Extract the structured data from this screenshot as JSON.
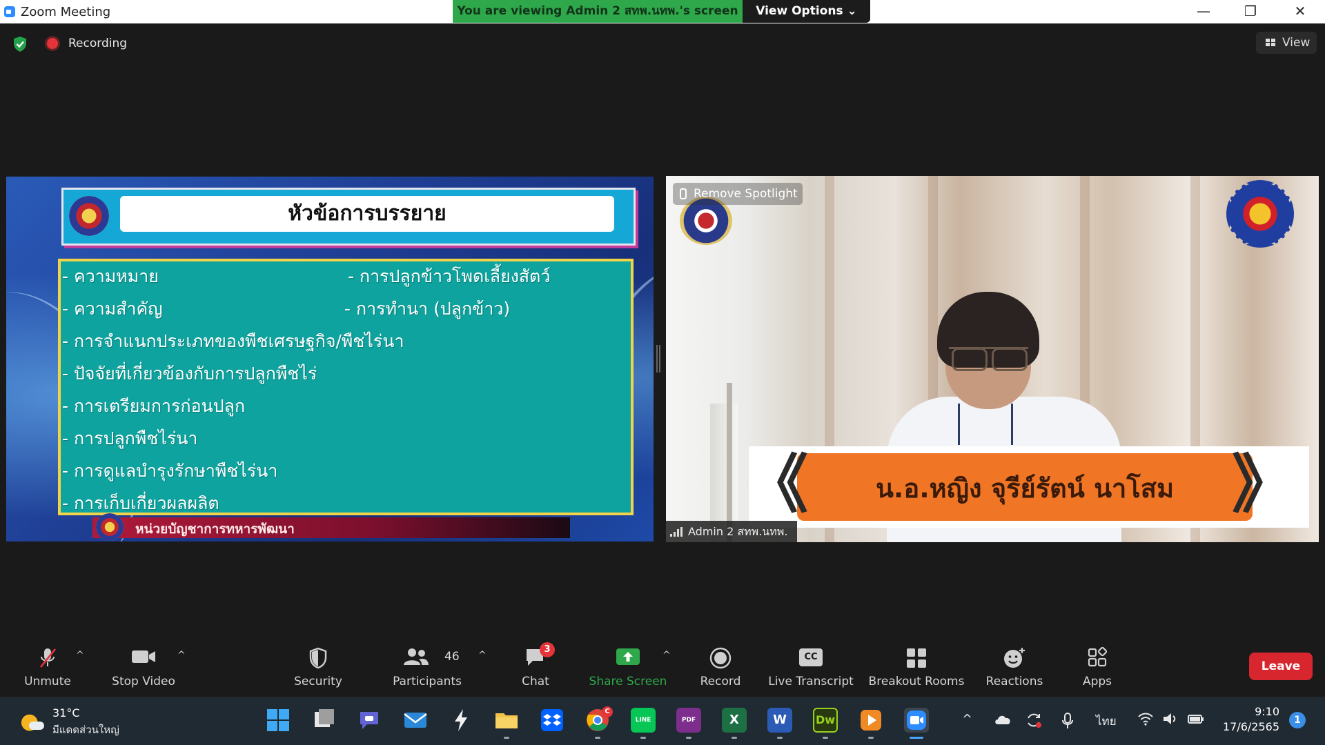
{
  "window": {
    "title": "Zoom Meeting",
    "viewing_banner": "You are viewing Admin 2 สทพ.นทพ.'s screen",
    "view_options": "View Options ⌄",
    "minimize": "—",
    "restore": "❐",
    "close": "✕"
  },
  "meeting_bar": {
    "recording_label": "Recording",
    "view_label": "View"
  },
  "slide": {
    "title": "หัวข้อการบรรยาย",
    "bullets_left": [
      "- ความหมาย",
      "- ความสำคัญ",
      "- การจำแนกประเภทของพืชเศรษฐกิจ/พืชไร่นา",
      "- ปัจจัยที่เกี่ยวข้องกับการปลูกพืชไร่",
      "- การเตรียมการก่อนปลูก",
      "- การปลูกพืชไร่นา",
      "- การดูแลบำรุงรักษาพืชไร่นา",
      "- การเก็บเกี่ยวผลผลิต"
    ],
    "bullets_right": [
      "- การปลูกข้าวโพดเลี้ยงสัตว์",
      "- การทำนา (ปลูกข้าว)"
    ],
    "footer": "หน่วยบัญชาการทหารพัฒนา"
  },
  "video": {
    "remove_spotlight": "Remove Spotlight",
    "participant_name": "Admin 2 สทพ.นทพ.",
    "nameplate_text": "น.อ.หญิง จุรีย์รัตน์ นาโสม",
    "chevron_left": "《",
    "chevron_right": "》"
  },
  "toolbar": {
    "unmute": "Unmute",
    "stop_video": "Stop Video",
    "security": "Security",
    "participants": "Participants",
    "participants_count": "46",
    "chat": "Chat",
    "chat_badge": "3",
    "share_screen": "Share Screen",
    "record": "Record",
    "live_transcript": "Live Transcript",
    "cc_label": "CC",
    "breakout_rooms": "Breakout Rooms",
    "reactions": "Reactions",
    "apps": "Apps",
    "leave": "Leave",
    "caret": "^"
  },
  "taskbar": {
    "weather_temp": "31°C",
    "weather_desc": "มีแดดส่วนใหญ่",
    "chrome_badge": "C",
    "line_label": "LINE",
    "dw_label": "Dw",
    "word_label": "W",
    "excel_label": "X",
    "pdf_label": "PDF",
    "language": "ไทย",
    "time": "9:10",
    "date": "17/6/2565",
    "notifications": "1",
    "tray_chevron": "^"
  },
  "colors": {
    "share_green": "#2ea84a",
    "leave_red": "#d8262e",
    "slide_teal": "#0ea39e",
    "slide_border": "#f3d34a",
    "nameplate_orange": "#f07625"
  }
}
